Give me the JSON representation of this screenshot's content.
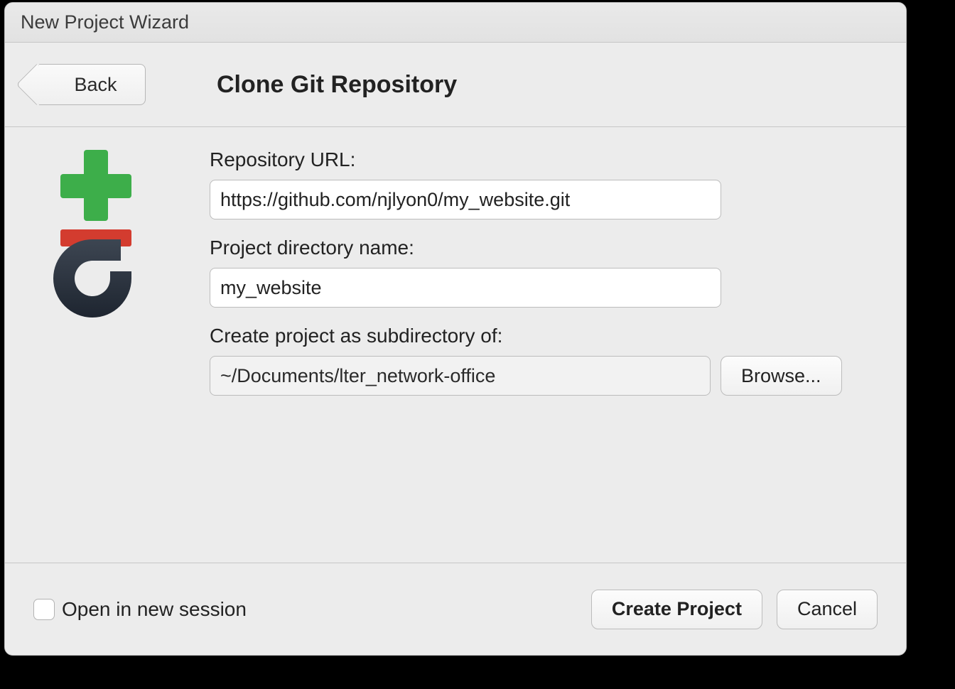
{
  "window": {
    "title": "New Project Wizard"
  },
  "header": {
    "back_label": "Back",
    "page_title": "Clone Git Repository"
  },
  "form": {
    "repo_url_label": "Repository URL:",
    "repo_url_value": "https://github.com/njlyon0/my_website.git",
    "dir_name_label": "Project directory name:",
    "dir_name_value": "my_website",
    "subdir_label": "Create project as subdirectory of:",
    "subdir_value": "~/Documents/lter_network-office",
    "browse_label": "Browse..."
  },
  "footer": {
    "open_new_session_label": "Open in new session",
    "create_label": "Create Project",
    "cancel_label": "Cancel"
  }
}
